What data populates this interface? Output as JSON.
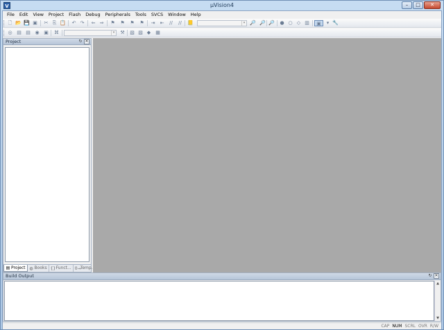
{
  "window": {
    "app_icon_letter": "V",
    "title": "µVision4",
    "buttons": {
      "minimize": "–",
      "maximize": "□",
      "close": "✕"
    }
  },
  "menubar": {
    "items": [
      "File",
      "Edit",
      "View",
      "Project",
      "Flash",
      "Debug",
      "Peripherals",
      "Tools",
      "SVCS",
      "Window",
      "Help"
    ]
  },
  "toolbar": {
    "icons": {
      "new": "🗋",
      "open": "📂",
      "save": "💾",
      "save_all": "▣",
      "cut": "✂",
      "copy": "⎘",
      "paste": "📋",
      "undo": "↶",
      "redo": "↷",
      "nav_back": "⇐",
      "nav_fwd": "⇒",
      "bookmark_set": "⚑",
      "bookmark_prev": "⚑",
      "bookmark_next": "⚑",
      "bookmark_clear": "⚑",
      "indent": "⇥",
      "unindent": "⇤",
      "comment": "//",
      "uncomment": "//",
      "find_in_files": "📒",
      "find": "🔎",
      "debug_start": "●",
      "breakpoint_insert": "○",
      "breakpoint_disable": "◇",
      "breakpoint_kill": "▥",
      "window_layout": "▣",
      "config": "🔧",
      "combo_arrow": "▾"
    },
    "build_icons": {
      "translate": "◎",
      "build": "▤",
      "rebuild": "▤",
      "batch": "◉",
      "stop": "▣",
      "download": "⌘",
      "target_options": "⚒",
      "file_extensions": "▧",
      "manage_components": "◆",
      "env": "▦",
      "combo_arrow": "▾"
    }
  },
  "project_pane": {
    "title": "Project",
    "pin_icon": "↻",
    "close_icon": "✕",
    "tabs": [
      {
        "icon": "▤",
        "label": "Project"
      },
      {
        "icon": "◍",
        "label": "Books"
      },
      {
        "icon": "{}",
        "label": "Funct..."
      },
      {
        "icon": "0→",
        "label": "Temp..."
      }
    ]
  },
  "build_output": {
    "title": "Build Output",
    "pin_icon": "↻",
    "close_icon": "✕",
    "scroll_up": "▲",
    "scroll_down": "▼"
  },
  "statusbar": {
    "indicators": [
      {
        "label": "CAP",
        "on": false
      },
      {
        "label": "NUM",
        "on": true
      },
      {
        "label": "SCRL",
        "on": false
      },
      {
        "label": "OVR",
        "on": false
      },
      {
        "label": "R/W",
        "on": false
      }
    ]
  }
}
